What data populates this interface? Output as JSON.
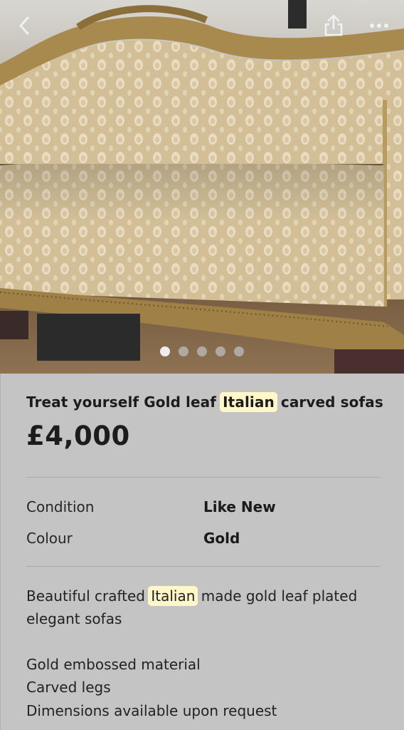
{
  "listing": {
    "title_before": "Treat yourself Gold leaf ",
    "title_highlight": "Italian",
    "title_after": " carved sofas",
    "price": "£4,000",
    "photo_count": 5,
    "active_photo": 1
  },
  "specs": {
    "condition_label": "Condition",
    "condition_value": "Like New",
    "colour_label": "Colour",
    "colour_value": "Gold"
  },
  "description": {
    "line1_before": "Beautiful crafted ",
    "line1_highlight": "Italian",
    "line1_after": " made gold leaf plated",
    "line2": "elegant sofas",
    "line3": "Gold embossed material",
    "line4": "Carved legs",
    "line5": "Dimensions available upon request"
  },
  "icons": {
    "back": "chevron-left-icon",
    "share": "share-icon",
    "more": "more-horizontal-icon"
  },
  "colors": {
    "background": "#c4c4c4",
    "highlight": "#fff6c9",
    "gold_frame": "#a88a4e",
    "fabric": "#d5c19b"
  }
}
